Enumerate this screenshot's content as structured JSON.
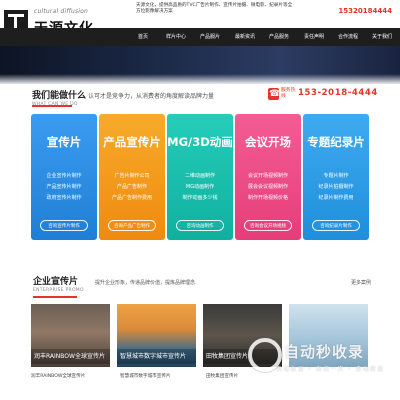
{
  "header": {
    "logo_en": "cultural diffusion",
    "logo_cn": "天源文化",
    "intro": "天源文化，提供高品质的TVC广告片制作、宣传片拍摄、微电影、纪录片等全方位影像解决方案",
    "phone": "15320184444"
  },
  "nav": {
    "items": [
      "首页",
      "样片中心",
      "产品服片",
      "最新资讯",
      "产品服务",
      "责任声明",
      "合作流程",
      "关于我们"
    ]
  },
  "services": {
    "title": "我们能做什么",
    "subtitle": "WHAT CAN WE DO",
    "desc": "认可才是竞争力，从消费者的角度解读品牌力量",
    "hotline_label": "服务热线",
    "hotline": "153-2018-4444",
    "cards": [
      {
        "title": "宣传片",
        "items": [
          "企业宣传片制作",
          "产品宣传片制作",
          "政府宣传片制作"
        ],
        "button": "咨询宣传片制作",
        "color": "#2e8fe0"
      },
      {
        "title": "产品宣传片",
        "items": [
          "广告片制作公司",
          "产品广告制作",
          "产品广告制作费用"
        ],
        "button": "咨询产品广告制作",
        "color": "#f39a18"
      },
      {
        "title": "MG/3D动画",
        "items": [
          "二维动画制作",
          "MG动画制作",
          "制作动画多少钱"
        ],
        "button": "咨询动画制作",
        "color": "#17bfae"
      },
      {
        "title": "会议开场",
        "items": [
          "会议开场视频制作",
          "展会会议视频制作",
          "制作开场视频价格"
        ],
        "button": "咨询会议开场视频",
        "color": "#ee4d86"
      },
      {
        "title": "专题纪录片",
        "items": [
          "专题片制作",
          "纪录片拍摄制作",
          "纪录片制作费用"
        ],
        "button": "咨询纪录片制作",
        "color": "#2f9ee6"
      }
    ]
  },
  "promo": {
    "title": "企业宣传片",
    "subtitle": "ENTERPRISE PROMO",
    "desc": "提升企业形象，传递品牌价值，提炼品牌理念",
    "more": "更多案例",
    "items": [
      {
        "caption": "润丰RAINBOW全球宣传片",
        "sub": "润丰RAINBOW全球宣传片"
      },
      {
        "caption": "智慧城市数字城市宣传片",
        "sub": "智慧城市数字城市宣传片"
      },
      {
        "caption": "田牧集团宣传片",
        "sub": "田牧集团宣传片"
      },
      {
        "caption": "",
        "sub": ""
      }
    ]
  },
  "watermark": {
    "text": "自动秒收录",
    "sub": "自动收录 • 来访一次 • 自动收录"
  }
}
